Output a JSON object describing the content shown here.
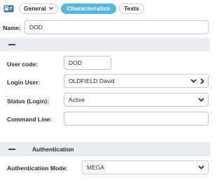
{
  "tabs": {
    "general": "General",
    "characteristics": "Characteristics",
    "texts": "Texts"
  },
  "name": {
    "label": "Name:",
    "value": "DOD"
  },
  "section1": {
    "title": ""
  },
  "user_code": {
    "label": "User code:",
    "value": "DOD"
  },
  "login_user": {
    "label": "Login User:",
    "value": "OLDFIELD David"
  },
  "status_login": {
    "label": "Status (Login):",
    "value": "Active"
  },
  "command_line": {
    "label": "Command Line:",
    "value": ""
  },
  "section2": {
    "title": "Authentication"
  },
  "auth_mode": {
    "label": "Authentication Mode:",
    "value": "MEGA"
  },
  "colors": {
    "accent": "#56b7e6",
    "section_bg": "#e9edf1",
    "border": "#bcc4cc"
  },
  "icons": [
    "id-card-icon",
    "chevron-down-icon",
    "chevron-right-icon"
  ]
}
